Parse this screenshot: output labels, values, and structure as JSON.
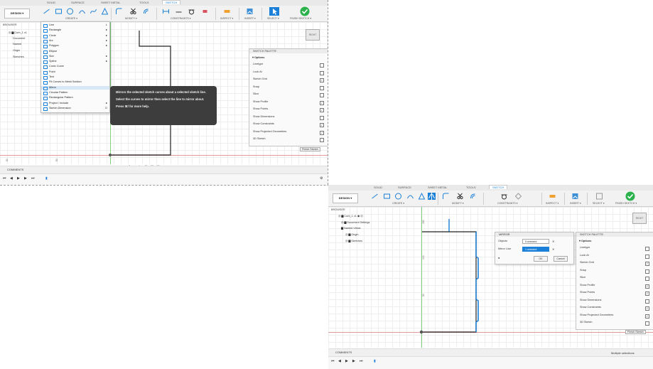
{
  "colors": {
    "accent": "#1c80d8",
    "finish": "#2bb24c",
    "grid": "#eeeeee",
    "axis_y": "#7fd07f",
    "axis_x": "#e59a9a",
    "tooltip_bg": "#3d3d3d"
  },
  "toolbar": {
    "tabs": [
      "SOLID",
      "SURFACE",
      "SHEET METAL",
      "TOOLS",
      "SKETCH"
    ],
    "design_label": "DESIGN ▾",
    "groups": {
      "create": "CREATE ▾",
      "modify": "MODIFY ▾",
      "constraints": "CONSTRAINTS ▾",
      "inspect": "INSPECT ▾",
      "insert": "INSERT ▾",
      "select": "SELECT ▾",
      "finish": "FINISH SKETCH ▾"
    }
  },
  "browser": {
    "title": "BROWSER",
    "items_a": [
      "Document",
      "Named",
      "Origin",
      "Sketches"
    ],
    "doc_name": "Curb_1 v1"
  },
  "create_menu": {
    "items": [
      {
        "label": "Line",
        "shortcut": "L",
        "arrow": ""
      },
      {
        "label": "Rectangle",
        "shortcut": "",
        "arrow": "▸"
      },
      {
        "label": "Circle",
        "shortcut": "",
        "arrow": "▸"
      },
      {
        "label": "Arc",
        "shortcut": "",
        "arrow": "▸"
      },
      {
        "label": "Polygon",
        "shortcut": "",
        "arrow": "▸"
      },
      {
        "label": "Ellipse",
        "shortcut": "",
        "arrow": ""
      },
      {
        "label": "Slot",
        "shortcut": "",
        "arrow": "▸"
      },
      {
        "label": "Spline",
        "shortcut": "",
        "arrow": "▸"
      },
      {
        "label": "Conic Curve",
        "shortcut": "",
        "arrow": ""
      },
      {
        "label": "Point",
        "shortcut": "",
        "arrow": ""
      },
      {
        "label": "Text",
        "shortcut": "",
        "arrow": ""
      },
      {
        "label": "Fit Curves to Mesh Section",
        "shortcut": "",
        "arrow": ""
      },
      {
        "label": "Mirror",
        "shortcut": "",
        "arrow": ""
      },
      {
        "label": "Circular Pattern",
        "shortcut": "",
        "arrow": ""
      },
      {
        "label": "Rectangular Pattern",
        "shortcut": "",
        "arrow": ""
      },
      {
        "label": "Project / Include",
        "shortcut": "",
        "arrow": "▸"
      },
      {
        "label": "Sketch Dimension",
        "shortcut": "D",
        "arrow": ""
      }
    ]
  },
  "tooltip": {
    "line1": "Mirrors the selected sketch curves about a selected sketch line.",
    "line2": "Select the curves to mirror then select the line to mirror about.",
    "line3": "Press ⌘/ for more help."
  },
  "palette": {
    "title": "SKETCH PALETTE",
    "options": "Options",
    "rows": [
      "Linetype",
      "Look At",
      "Sketch Grid",
      "Snap",
      "Slice",
      "Show Profile",
      "Show Points",
      "Show Dimensions",
      "Show Constraints",
      "Show Projected Geometries",
      "3D Sketch"
    ],
    "checked": [
      false,
      false,
      true,
      false,
      false,
      true,
      true,
      false,
      true,
      true,
      false
    ],
    "finish": "Finish Sketch"
  },
  "comments": "COMMENTS",
  "mirror_dialog": {
    "title": "MIRROR",
    "objects_label": "Objects",
    "objects_value": "5 selected",
    "line_label": "Mirror Line",
    "line_value": "1 selected",
    "ok": "OK",
    "cancel": "Cancel"
  },
  "browser_b": {
    "doc": "Curb_1 v1",
    "items": [
      "Document Settings",
      "Named Views",
      "Origin",
      "Sketches"
    ]
  },
  "dims": {
    "a1": "150",
    "a2": "100",
    "a3": "50",
    "b1": "150",
    "b2": "100",
    "b3": "50",
    "c": "50"
  },
  "viewcube": "RIGHT",
  "status_b": "Multiple selections"
}
